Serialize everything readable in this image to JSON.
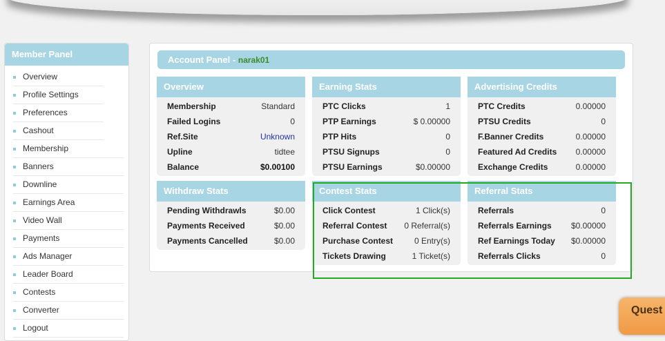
{
  "sidebar": {
    "title": "Member Panel",
    "items": [
      {
        "label": "Overview"
      },
      {
        "label": "Profile Settings"
      },
      {
        "label": "Preferences"
      },
      {
        "label": "Cashout"
      },
      {
        "label": "Membership"
      },
      {
        "label": "Banners"
      },
      {
        "label": "Downline"
      },
      {
        "label": "Earnings Area"
      },
      {
        "label": "Video Wall"
      },
      {
        "label": "Payments"
      },
      {
        "label": "Ads Manager"
      },
      {
        "label": "Leader Board"
      },
      {
        "label": "Contests"
      },
      {
        "label": "Converter"
      },
      {
        "label": "Logout"
      }
    ]
  },
  "account": {
    "title": "Account Panel",
    "separator": " - ",
    "username": "narak01"
  },
  "overview": {
    "title": "Overview",
    "rows": [
      {
        "label": "Membership",
        "value": "Standard"
      },
      {
        "label": "Failed Logins",
        "value": "0"
      },
      {
        "label": "Ref.Site",
        "value": "Unknown"
      },
      {
        "label": "Upline",
        "value": "tidtee"
      },
      {
        "label": "Balance",
        "value": "$0.00100"
      }
    ]
  },
  "earning": {
    "title": "Earning Stats",
    "rows": [
      {
        "label": "PTC Clicks",
        "value": "1"
      },
      {
        "label": "PTP Earnings",
        "value": "$ 0.00000"
      },
      {
        "label": "PTP Hits",
        "value": "0"
      },
      {
        "label": "PTSU Signups",
        "value": "0"
      },
      {
        "label": "PTSU Earnings",
        "value": "$0.00000"
      }
    ]
  },
  "advertising": {
    "title": "Advertising Credits",
    "rows": [
      {
        "label": "PTC Credits",
        "value": "0.00000"
      },
      {
        "label": "PTSU Credits",
        "value": "0"
      },
      {
        "label": "F.Banner Credits",
        "value": "0.00000"
      },
      {
        "label": "Featured Ad Credits",
        "value": "0.00000"
      },
      {
        "label": "Exchange Credits",
        "value": "0.00000"
      }
    ]
  },
  "withdraw": {
    "title": "Withdraw Stats",
    "rows": [
      {
        "label": "Pending Withdrawls",
        "value": "$0.00"
      },
      {
        "label": "Payments Received",
        "value": "$0.00"
      },
      {
        "label": "Payments Cancelled",
        "value": "$0.00"
      }
    ]
  },
  "contest": {
    "title": "Contest Stats",
    "rows": [
      {
        "label": "Click Contest",
        "value": "1 Click(s)"
      },
      {
        "label": "Referral Contest",
        "value": "0 Referral(s)"
      },
      {
        "label": "Purchase Contest",
        "value": "0 Entry(s)"
      },
      {
        "label": "Tickets Drawing",
        "value": "1 Ticket(s)"
      }
    ]
  },
  "referral": {
    "title": "Referral Stats",
    "rows": [
      {
        "label": "Referrals",
        "value": "0"
      },
      {
        "label": "Referrals Earnings",
        "value": "$0.00000"
      },
      {
        "label": "Ref Earnings Today",
        "value": "$0.00000"
      },
      {
        "label": "Referrals Clicks",
        "value": "0"
      }
    ]
  },
  "quest_button": {
    "label": "Quest"
  },
  "colors": {
    "panel_header": "#a8d5e4",
    "username": "#3d8a2a",
    "highlight_border": "#22aa22",
    "quest_button": "#f0a050"
  }
}
